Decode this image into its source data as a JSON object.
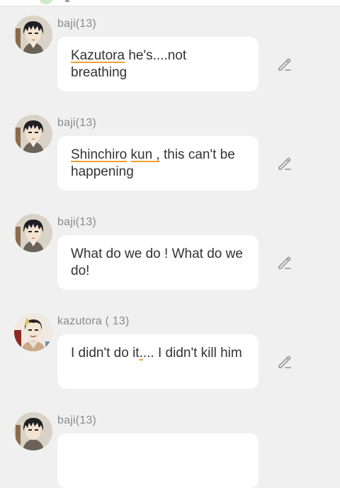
{
  "colors": {
    "background": "#f0f0f0",
    "bubble": "#ffffff",
    "sender_text": "#8a8a8a",
    "message_text": "#333333",
    "spellcheck_underline": "#f0a030",
    "edit_icon": "#9e9e9e"
  },
  "messages": [
    {
      "sender": "baji(13)",
      "avatar_icon": "baji-avatar-icon",
      "text_parts": [
        {
          "text": "Kazutora",
          "flagged": true
        },
        {
          "text": " he's....not breathing",
          "flagged": false
        }
      ],
      "action_icon": "pencil-edit-icon"
    },
    {
      "sender": "baji(13)",
      "avatar_icon": "baji-avatar-icon",
      "text_parts": [
        {
          "text": "Shinchiro",
          "flagged": true
        },
        {
          "text": " ",
          "flagged": false
        },
        {
          "text": "kun ,",
          "flagged": true
        },
        {
          "text": " this can't be happening",
          "flagged": false
        }
      ],
      "action_icon": "pencil-edit-icon"
    },
    {
      "sender": "baji(13)",
      "avatar_icon": "baji-avatar-icon",
      "text_parts": [
        {
          "text": "What do we do ! What do we do!",
          "flagged": false
        }
      ],
      "action_icon": "pencil-edit-icon"
    },
    {
      "sender": "kazutora ( 13)",
      "avatar_icon": "kazutora-avatar-icon",
      "text_parts": [
        {
          "text": "I didn't do it",
          "flagged": false
        },
        {
          "text": ".",
          "flagged": true
        },
        {
          "text": "... I didn't kill him",
          "flagged": false
        }
      ],
      "action_icon": "pencil-edit-icon"
    },
    {
      "sender": "baji(13)",
      "avatar_icon": "baji-avatar-icon",
      "text_parts": [],
      "action_icon": "pencil-edit-icon"
    }
  ]
}
